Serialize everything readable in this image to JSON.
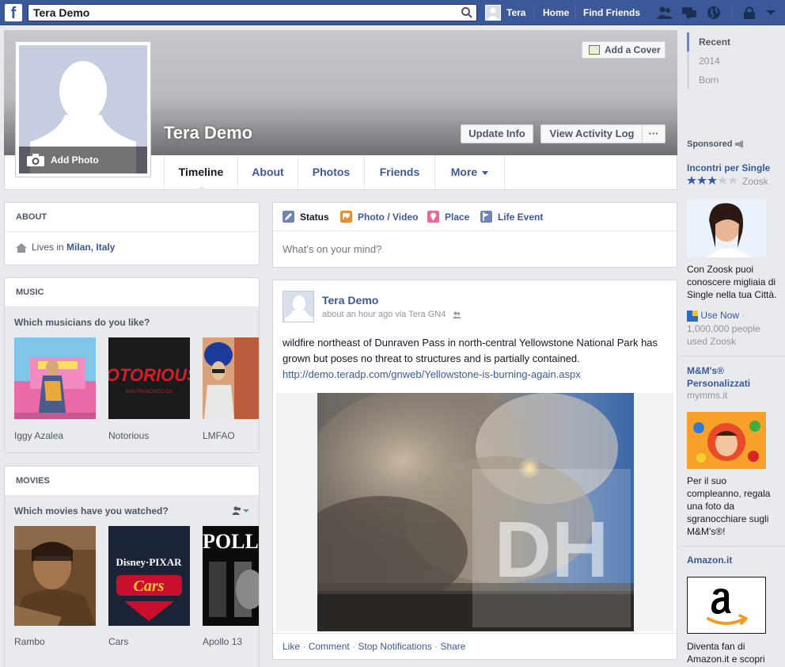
{
  "topbar": {
    "logo": "f",
    "search_value": "Tera Demo",
    "user_name": "Tera",
    "home": "Home",
    "find_friends": "Find Friends"
  },
  "profile": {
    "name": "Tera Demo",
    "add_photo": "Add Photo",
    "add_cover": "Add a Cover",
    "update_info": "Update Info",
    "activity_log": "View Activity Log",
    "more_dots": "···"
  },
  "tabs": [
    {
      "label": "Timeline"
    },
    {
      "label": "About"
    },
    {
      "label": "Photos"
    },
    {
      "label": "Friends"
    },
    {
      "label": "More"
    }
  ],
  "about": {
    "header": "ABOUT",
    "lives_prefix": "Lives in ",
    "lives_city": "Milan, Italy"
  },
  "music": {
    "header": "MUSIC",
    "prompt": "Which musicians do you like?",
    "items": [
      "Iggy Azalea",
      "Notorious",
      "LMFAO"
    ],
    "notorious_art": "NOTORIOUS!",
    "notorious_sub": "SAN FRANCISCO CA"
  },
  "movies": {
    "header": "MOVIES",
    "prompt": "Which movies have you watched?",
    "items": [
      "Rambo",
      "Cars",
      "Apollo 13"
    ],
    "cars_brand": "Disney·PIXAR",
    "cars_title": "Cars",
    "apollo_art": "POLLO"
  },
  "composer": {
    "tabs": [
      "Status",
      "Photo / Video",
      "Place",
      "Life Event"
    ],
    "placeholder": "What's on your mind?"
  },
  "post": {
    "author": "Tera Demo",
    "meta": "about an hour ago via Tera GN4",
    "text": "wildfire northeast of Dunraven Pass in north-central Yellowstone National Park has grown but poses no threat to structures and is partially contained.",
    "link": "http://demo.teradp.com/gnweb/Yellowstone-is-burning-again.aspx",
    "watermark": "DH",
    "actions": {
      "like": "Like",
      "comment": "Comment",
      "stop": "Stop Notifications",
      "share": "Share",
      "sep": " · "
    }
  },
  "timeline_nav": [
    "Recent",
    "2014",
    "Born"
  ],
  "sponsored": "Sponsored",
  "ads": [
    {
      "title": "Incontri per Single",
      "sub": "Zoosk",
      "body": "Con Zoosk puoi conoscere migliaia di Single nella tua Città.",
      "cta": "Use Now",
      "cta_sep": " · ",
      "social": "1,000,000 people used Zoosk"
    },
    {
      "title": "M&M's® Personalizzati",
      "sub": "mymms.it",
      "body": "Per il suo compleanno, regala una foto da sgranocchiare sugli M&M's®!"
    },
    {
      "title": "Amazon.it",
      "body": "Diventa fan di Amazon.it e scopri"
    }
  ],
  "colors": {
    "brand": "#3b5998",
    "bg": "#e9eaed"
  }
}
